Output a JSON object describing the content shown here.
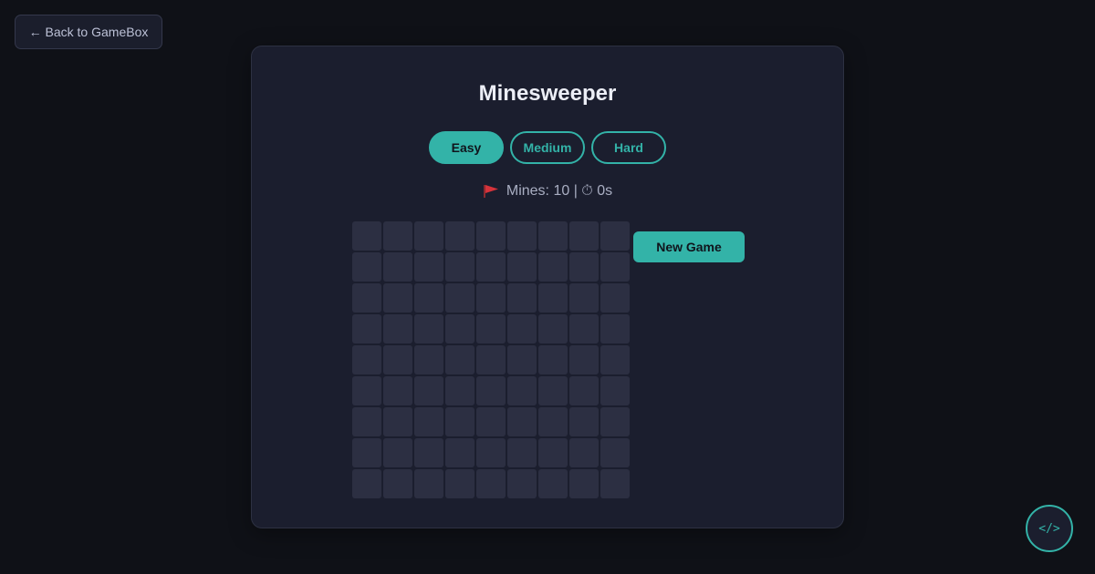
{
  "nav": {
    "back_label": "← Back to GameBox"
  },
  "game": {
    "title": "Minesweeper",
    "difficulties": [
      {
        "label": "Easy",
        "active": true
      },
      {
        "label": "Medium",
        "active": false
      },
      {
        "label": "Hard",
        "active": false
      }
    ],
    "status": {
      "flag_icon": "flag-icon",
      "mines_text": "Mines: 10 | ⏱ 0s"
    },
    "board": {
      "rows": 9,
      "cols": 9,
      "state": "all-hidden"
    },
    "new_game_label": "New Game"
  },
  "code_toggle": {
    "label": "</>",
    "icon": "code-icon"
  },
  "colors": {
    "background": "#0f1117",
    "panel": "#1b1e2e",
    "accent": "#33b3a8",
    "cell": "#2c2f42",
    "flag": "#d6333b"
  }
}
